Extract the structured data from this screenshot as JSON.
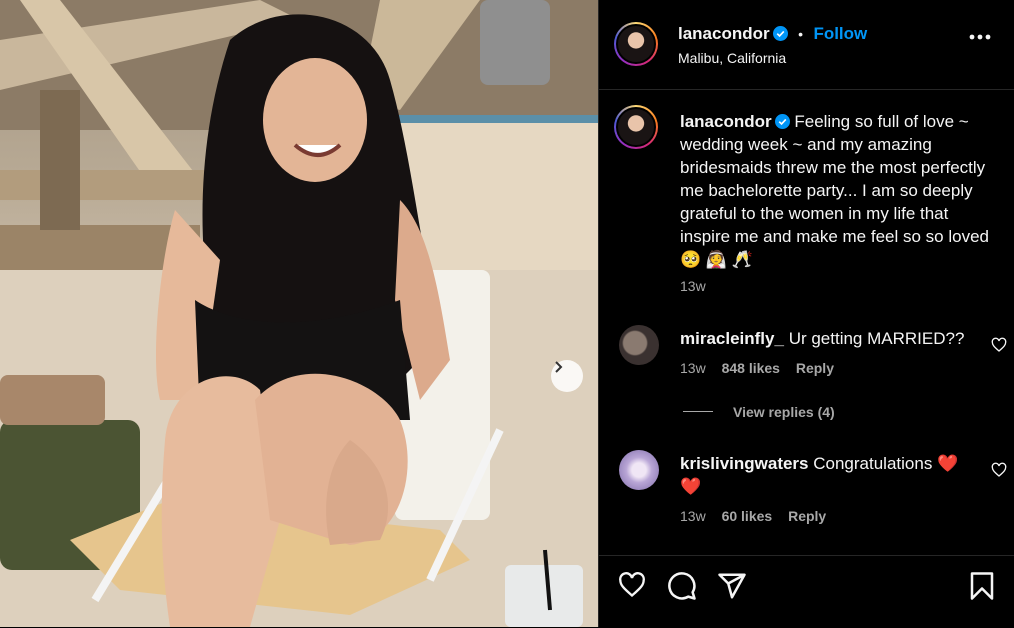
{
  "post": {
    "username": "lanacondor",
    "follow_label": "Follow",
    "separator": "•",
    "location": "Malibu, California",
    "caption_text": "Feeling so full of love ~ wedding week ~ and my amazing bridesmaids threw me the most perfectly me bachelorette party... I am so deeply grateful to the women in my life that inspire me and make me feel so so loved 🥺 👰 🥂",
    "caption_time": "13w"
  },
  "comments": [
    {
      "username": "miracleinfly_",
      "text": "Ur getting MARRIED??",
      "time": "13w",
      "likes": "848 likes",
      "reply_label": "Reply",
      "view_replies": "View replies (4)"
    },
    {
      "username": "krislivingwaters",
      "text": "Congratulations ❤️ ❤️",
      "time": "13w",
      "likes": "60 likes",
      "reply_label": "Reply"
    }
  ],
  "icons": {
    "more": "more-options-icon",
    "verified": "verified-badge-icon",
    "like": "heart-icon",
    "comment": "comment-icon",
    "share": "share-icon",
    "save": "bookmark-icon",
    "next": "chevron-right-icon"
  },
  "colors": {
    "accent": "#0095f6",
    "background": "#000000",
    "secondary_text": "#a8a8a8"
  }
}
